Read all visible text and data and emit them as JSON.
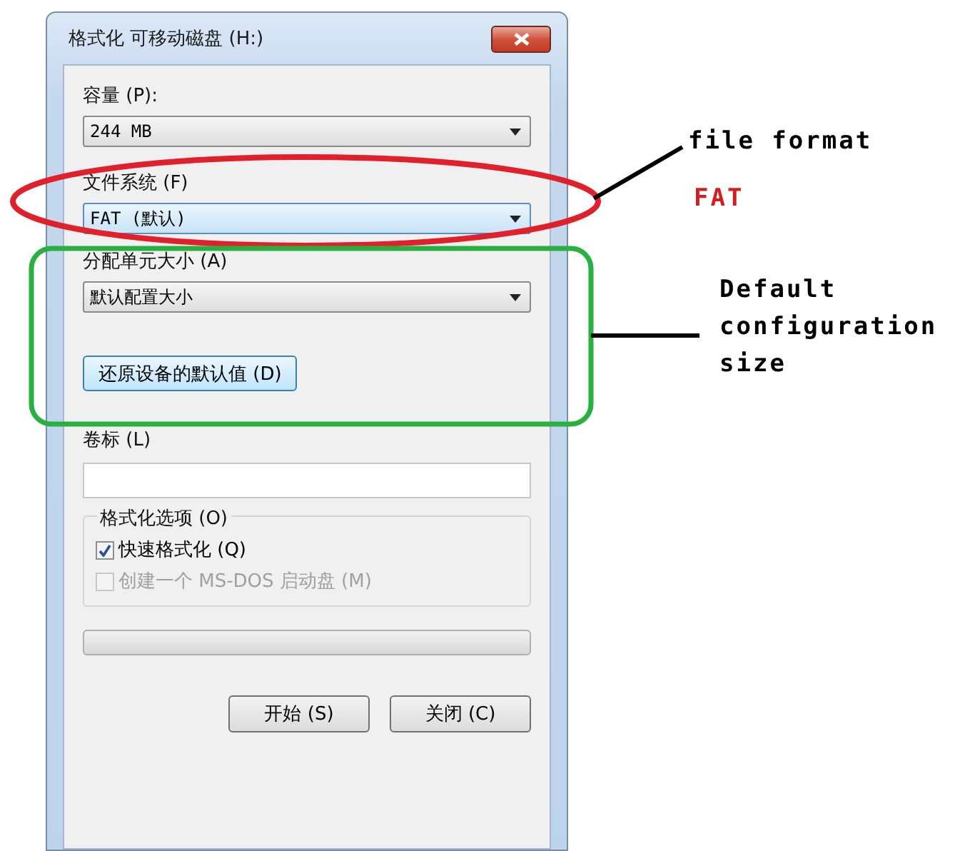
{
  "window": {
    "title": "格式化 可移动磁盘 (H:)"
  },
  "dropdowns": [
    {
      "label": "容量 (P):",
      "value": "244 MB",
      "kind": "plain"
    },
    {
      "label": "文件系统 (F)",
      "value": "FAT (默认)",
      "kind": "focused"
    },
    {
      "label": "分配单元大小 (A)",
      "value": "默认配置大小",
      "kind": "plain"
    }
  ],
  "restore_button": "还原设备的默认值 (D)",
  "volume_label": {
    "label": "卷标 (L)"
  },
  "format_options": {
    "title": "格式化选项 (O)",
    "options": [
      {
        "label": "快速格式化 (Q)",
        "checked": true,
        "disabled": false
      },
      {
        "label": "创建一个 MS-DOS 启动盘 (M)",
        "checked": false,
        "disabled": true
      }
    ]
  },
  "progress": {
    "level": 0
  },
  "buttons": [
    "开始 (S)",
    "关闭 (C)"
  ],
  "annotations": [
    {
      "text": "file format",
      "color": "#000000"
    },
    {
      "text": "FAT",
      "color": "#d02020"
    },
    {
      "text": "Default configuration size",
      "color": "#000000"
    }
  ]
}
